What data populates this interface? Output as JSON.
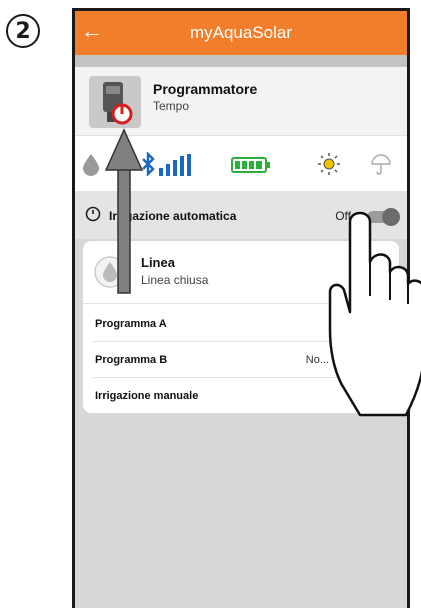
{
  "step": {
    "number": "2"
  },
  "appbar": {
    "title": "myAquaSolar",
    "back_icon": "arrow-left-icon"
  },
  "device": {
    "name": "Programmatore",
    "subtitle": "Tempo"
  },
  "status_icons": [
    "water-drop-icon",
    "bluetooth-icon",
    "signal-bars-icon",
    "battery-icon",
    "sun-icon",
    "umbrella-icon"
  ],
  "auto_irrigation": {
    "label": "Irrigazione automatica",
    "value": "Off",
    "enabled": false
  },
  "line": {
    "title": "Linea",
    "subtitle": "Linea chiusa"
  },
  "programs": [
    {
      "label": "Programma A",
      "value": ""
    },
    {
      "label": "Programma B",
      "value": "No..."
    },
    {
      "label": "Irrigazione manuale",
      "value": ""
    }
  ],
  "colors": {
    "accent": "#f27d2a",
    "icon_blue": "#1a67c4",
    "battery_green": "#2cae3c",
    "sun_yellow": "#f2c200"
  }
}
